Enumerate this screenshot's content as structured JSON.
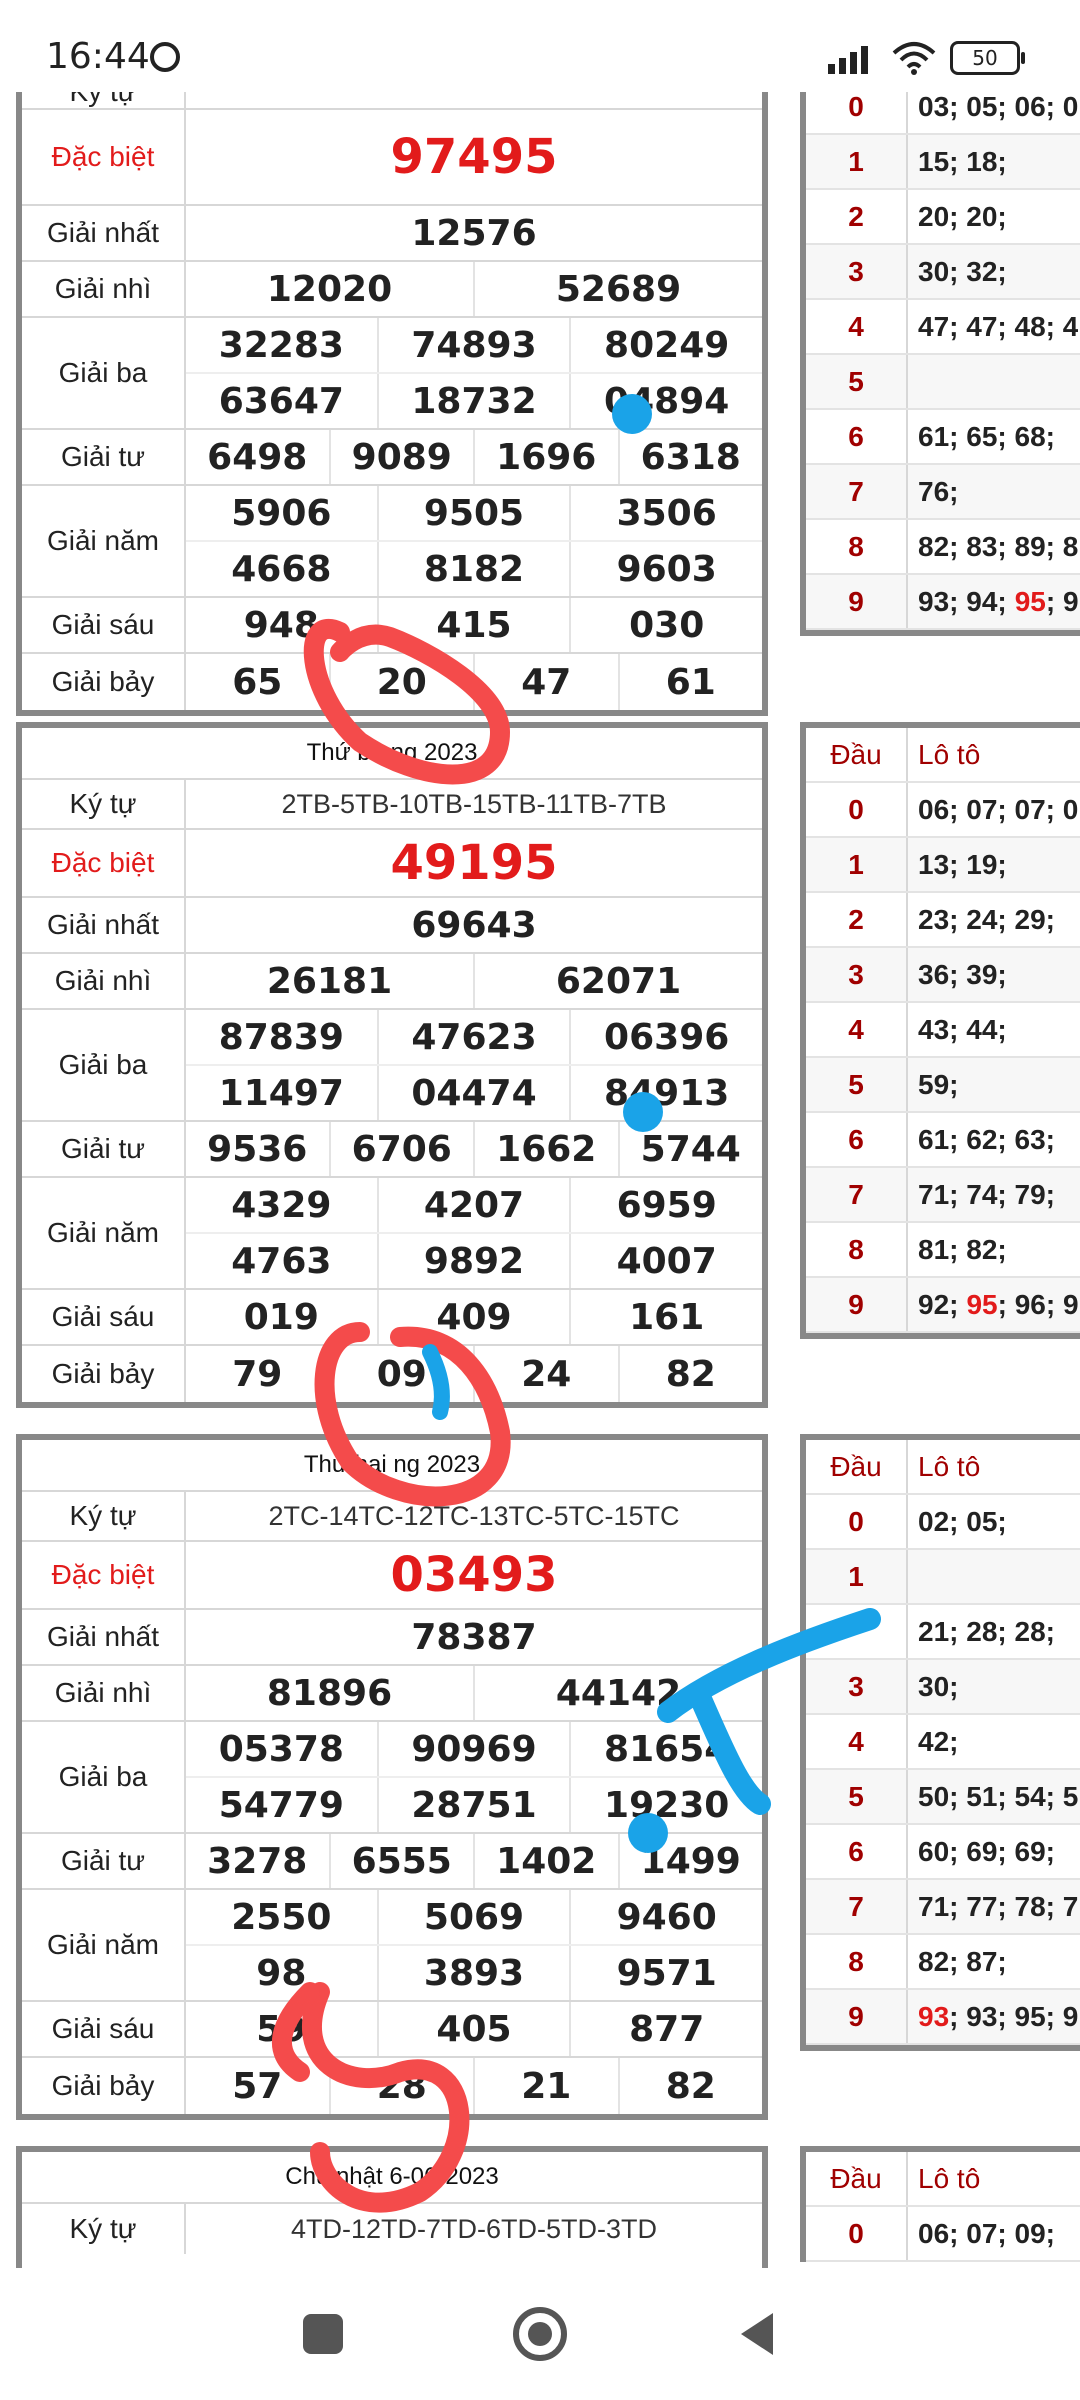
{
  "status": {
    "time": "16:44",
    "battery": "50"
  },
  "labels": {
    "ky_tu": "Ký tự",
    "dac_biet": "Đặc biệt",
    "nhat": "Giải nhất",
    "nhi": "Giải nhì",
    "ba": "Giải ba",
    "tu": "Giải tư",
    "nam": "Giải năm",
    "sau": "Giải sáu",
    "bay": "Giải bảy",
    "dau": "Đầu",
    "loto": "Lô tô"
  },
  "blocks": [
    {
      "header": "",
      "ky_tu": "",
      "db": "97495",
      "nhat": "12576",
      "nhi": [
        "12020",
        "52689"
      ],
      "ba": [
        [
          "32283",
          "74893",
          "80249"
        ],
        [
          "63647",
          "18732",
          "04894"
        ]
      ],
      "tu": [
        "6498",
        "9089",
        "1696",
        "6318"
      ],
      "nam": [
        [
          "5906",
          "9505",
          "3506"
        ],
        [
          "4668",
          "8182",
          "9603"
        ]
      ],
      "sau": [
        "948",
        "415",
        "030"
      ],
      "bay": [
        "65",
        "20",
        "47",
        "61"
      ]
    },
    {
      "header": "Thứ ba ng          2023",
      "ky_tu": "2TB-5TB-10TB-15TB-11TB-7TB",
      "db": "49195",
      "nhat": "69643",
      "nhi": [
        "26181",
        "62071"
      ],
      "ba": [
        [
          "87839",
          "47623",
          "06396"
        ],
        [
          "11497",
          "04474",
          "84913"
        ]
      ],
      "tu": [
        "9536",
        "6706",
        "1662",
        "5744"
      ],
      "nam": [
        [
          "4329",
          "4207",
          "6959"
        ],
        [
          "4763",
          "9892",
          "4007"
        ]
      ],
      "sau": [
        "019",
        "409",
        "161"
      ],
      "bay": [
        "79",
        "09",
        "24",
        "82"
      ]
    },
    {
      "header": "Thứ hai ng          2023",
      "ky_tu": "2TC-14TC-12TC-13TC-5TC-15TC",
      "db": "03493",
      "nhat": "78387",
      "nhi": [
        "81896",
        "44142"
      ],
      "ba": [
        [
          "05378",
          "90969",
          "81654"
        ],
        [
          "54779",
          "28751",
          "19230"
        ]
      ],
      "tu": [
        "3278",
        "6555",
        "1402",
        "1499"
      ],
      "nam": [
        [
          "2550",
          "5069",
          "9460"
        ],
        [
          "98",
          "3893",
          "9571"
        ]
      ],
      "sau": [
        "59",
        "405",
        "877"
      ],
      "bay": [
        "57",
        "28",
        "21",
        "82"
      ]
    },
    {
      "header": "Chủ nhật          6-06-2023",
      "ky_tu": "4TD-12TD-7TD-6TD-5TD-3TD"
    }
  ],
  "loto_tables": [
    {
      "rows": [
        {
          "d": "0",
          "v": "03; 05; 06; 0"
        },
        {
          "d": "1",
          "v": "15; 18;"
        },
        {
          "d": "2",
          "v": "20; 20;"
        },
        {
          "d": "3",
          "v": "30; 32;"
        },
        {
          "d": "4",
          "v": "47; 47; 48; 4"
        },
        {
          "d": "5",
          "v": ""
        },
        {
          "d": "6",
          "v": "61; 65; 68;"
        },
        {
          "d": "7",
          "v": "76;"
        },
        {
          "d": "8",
          "v": "82; 83; 89; 8"
        },
        {
          "d": "9",
          "v": "93; 94;",
          "red": "95",
          "rest": "; 9"
        }
      ]
    },
    {
      "rows": [
        {
          "d": "0",
          "v": "06; 07; 07; 0"
        },
        {
          "d": "1",
          "v": "13; 19;"
        },
        {
          "d": "2",
          "v": "23; 24; 29;"
        },
        {
          "d": "3",
          "v": "36; 39;"
        },
        {
          "d": "4",
          "v": "43; 44;"
        },
        {
          "d": "5",
          "v": "59;"
        },
        {
          "d": "6",
          "v": "61; 62; 63;"
        },
        {
          "d": "7",
          "v": "71; 74; 79;"
        },
        {
          "d": "8",
          "v": "81; 82;"
        },
        {
          "d": "9",
          "v": "92;",
          "red": "95",
          "rest": "; 96; 9"
        }
      ]
    },
    {
      "rows": [
        {
          "d": "0",
          "v": "02; 05;"
        },
        {
          "d": "1",
          "v": ""
        },
        {
          "d": "",
          "v": "21; 28; 28;"
        },
        {
          "d": "3",
          "v": "30;"
        },
        {
          "d": "4",
          "v": "42;"
        },
        {
          "d": "5",
          "v": "50; 51; 54; 5"
        },
        {
          "d": "6",
          "v": "60; 69; 69;"
        },
        {
          "d": "7",
          "v": "71; 77; 78; 7"
        },
        {
          "d": "8",
          "v": "82; 87;"
        },
        {
          "d": "9",
          "v": "",
          "red": "93",
          "rest": "; 93; 95; 9"
        }
      ]
    },
    {
      "rows": [
        {
          "d": "0",
          "v": "06; 07; 09;"
        }
      ]
    }
  ],
  "colors": {
    "red": "#e21b1b",
    "dark_red": "#a00000",
    "annot_red": "#f44b4b",
    "annot_blue": "#1aa3e8"
  }
}
